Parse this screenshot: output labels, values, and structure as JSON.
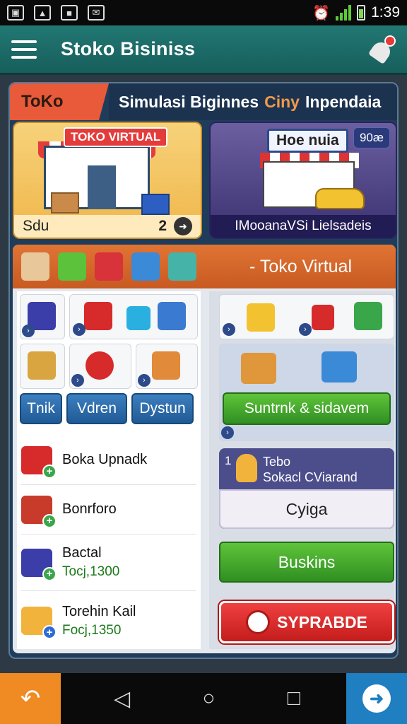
{
  "status": {
    "time": "1:39"
  },
  "appbar": {
    "title": "Stoko Bisiniss"
  },
  "hero": {
    "tab": "ToKo",
    "subtitle_a": "Simulasi Biginnes",
    "subtitle_b": "Ciny",
    "subtitle_c": "Inpendaia"
  },
  "card1": {
    "sign": "TOKO VIRTUAL",
    "footer": "Sdu",
    "count": "2"
  },
  "card2": {
    "sign": "Hoe nuia",
    "price": "90æ",
    "footer": "IMooanaVSi Lielsadeis"
  },
  "panel": {
    "title": "- Toko Virtual",
    "btn1": "Tnik",
    "btn2": "Vdren",
    "btn3": "Dystun",
    "green1": "Suntrnk & sidavem",
    "list": [
      {
        "title": "Boka Upnadk",
        "price": ""
      },
      {
        "title": "Bonrforo",
        "price": ""
      },
      {
        "title": "Bactal",
        "price": "Tocj,1300"
      },
      {
        "title": "Torehin Kail",
        "price": "Focj,1350"
      }
    ],
    "promo": {
      "num": "1",
      "line1": "Tebo",
      "line2": "Sokacl CViarand",
      "field": "Cyiga"
    },
    "green2": "Buskins",
    "red": "SYPRABDE"
  },
  "colors": {
    "accent": "#227874",
    "panel_header": "#e07434",
    "cta_green": "#3aa64a",
    "cta_red": "#e53935"
  }
}
